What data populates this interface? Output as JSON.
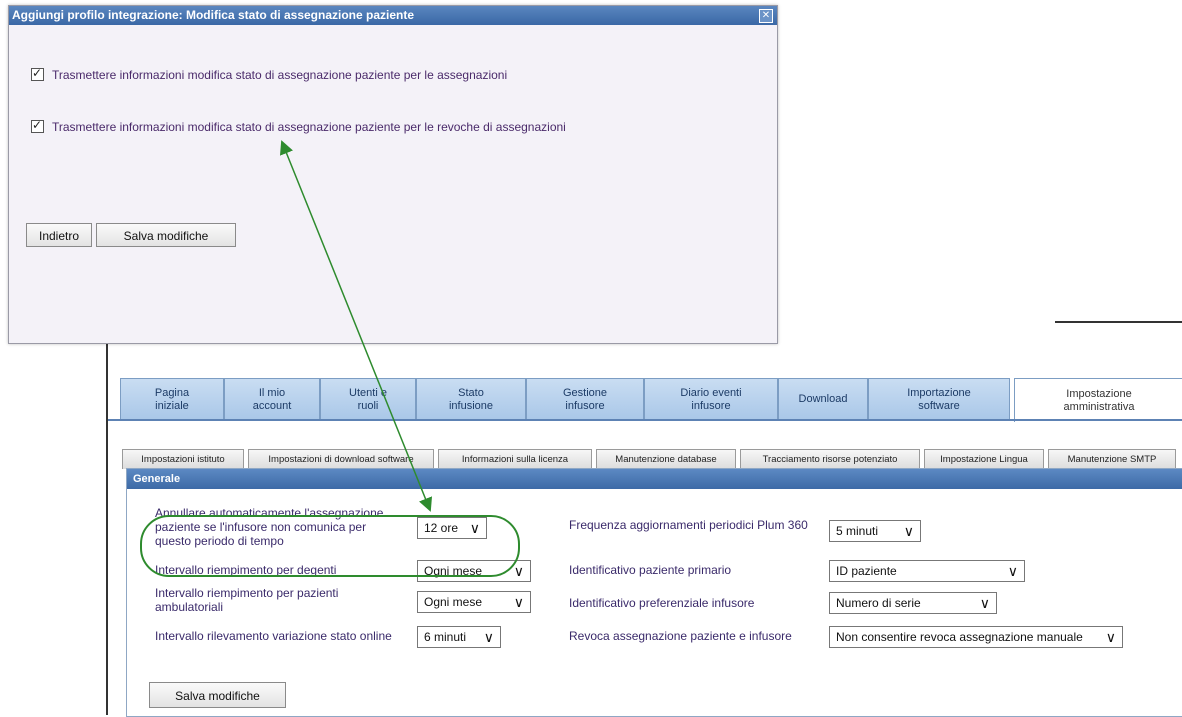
{
  "dialog": {
    "title": "Aggiungi profilo integrazione: Modifica stato di assegnazione paziente",
    "close_glyph": "✕",
    "checkbox1_label": "Trasmettere informazioni modifica stato di assegnazione paziente per le assegnazioni",
    "checkbox1_checked": true,
    "checkbox2_label": "Trasmettere informazioni modifica stato di assegnazione paziente per le revoche di assegnazioni",
    "checkbox2_checked": true,
    "back_button": "Indietro",
    "save_button": "Salva modifiche"
  },
  "main_tabs": [
    {
      "line1": "Pagina",
      "line2": "iniziale"
    },
    {
      "line1": "Il mio",
      "line2": "account"
    },
    {
      "line1": "Utenti e",
      "line2": "ruoli"
    },
    {
      "line1": "Stato",
      "line2": "infusione"
    },
    {
      "line1": "Gestione",
      "line2": "infusore"
    },
    {
      "line1": "Diario eventi",
      "line2": "infusore"
    },
    {
      "line1": "Download",
      "line2": ""
    },
    {
      "line1": "Importazione",
      "line2": "software"
    },
    {
      "line1": "Impostazione",
      "line2": "amministrativa",
      "active": true
    }
  ],
  "sub_tabs": [
    "Impostazioni istituto",
    "Impostazioni di download software",
    "Informazioni sulla licenza",
    "Manutenzione database",
    "Tracciamento risorse potenziato",
    "Impostazione Lingua",
    "Manutenzione SMTP"
  ],
  "panel": {
    "title": "Generale",
    "left_fields": [
      {
        "label": "Annullare automaticamente l'assegnazione paziente se l'infusore non comunica per questo periodo di tempo",
        "value": "12 ore"
      },
      {
        "label": "Intervallo riempimento per degenti",
        "value": "Ogni mese"
      },
      {
        "label": "Intervallo riempimento per pazienti ambulatoriali",
        "value": "Ogni mese"
      },
      {
        "label": "Intervallo rilevamento variazione stato online",
        "value": "6 minuti"
      }
    ],
    "right_fields": [
      {
        "label": "Frequenza aggiornamenti periodici Plum 360",
        "value": "5 minuti"
      },
      {
        "label": "Identificativo paziente primario",
        "value": "ID paziente"
      },
      {
        "label": "Identificativo preferenziale infusore",
        "value": "Numero di serie"
      },
      {
        "label": "Revoca assegnazione paziente e infusore",
        "value": "Non consentire revoca assegnazione manuale"
      }
    ],
    "save_button": "Salva modifiche"
  },
  "annotation": {
    "color": "#2e8b2e"
  }
}
